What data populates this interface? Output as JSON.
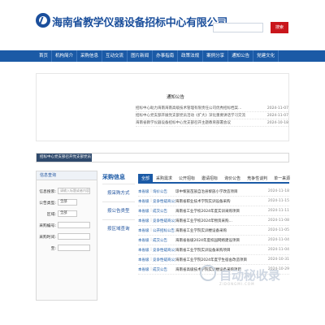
{
  "header": {
    "site_title": "海南省教学仪器设备招标中心有限公司",
    "search_placeholder": "",
    "search_label": "搜索"
  },
  "nav": {
    "items": [
      "首页",
      "机构简介",
      "采购信息",
      "互动交流",
      "图片新闻",
      "办事指南",
      "政策法规",
      "案例分享",
      "通知公告",
      "党建文化"
    ]
  },
  "notice": {
    "title": "通知公告",
    "rows": [
      {
        "title": "招标中心助力海南海南高级技术管理有限责任公司优秀招标档案…",
        "date": "2024-11-07"
      },
      {
        "title": "招标中心党支部开展党支部党员活动《扩大》深化重要讲话学习交流",
        "date": "2024-11-07"
      },
      {
        "title": "海南省教学仪器设备招标中心党支部召开主题教育部署会议",
        "date": "2024-10-18"
      }
    ]
  },
  "strip": {
    "label": "招标中心党支部召开党支部党员"
  },
  "left_panel": {
    "head": "信息查询",
    "keyword_label": "信息搜索:",
    "keyword_placeholder": "请输入标题或者内容",
    "type_label": "公告类型:",
    "type_value": "全部",
    "region_label": "区域:",
    "region_value": "全部",
    "code_label": "采购编号:",
    "from_label": "采购时间:",
    "to_label": "至:"
  },
  "caigou": {
    "head": "采购信息",
    "side": [
      "按采购方式",
      "按公告类型",
      "按区域查询"
    ]
  },
  "tabs": [
    "全部",
    "采购需求",
    "公开招标",
    "邀请招标",
    "询价公告",
    "竞争性谈判",
    "单一来源"
  ],
  "list": [
    {
      "src": "本省级",
      "cat": "询价公告",
      "title": "琼中黎族苗族自治县黎族小学改造项目",
      "date": "2024-11-18"
    },
    {
      "src": "本省级",
      "cat": "竞争性磋商公告",
      "title": "海南省职业技术学院实训设备采购",
      "date": "2024-11-15"
    },
    {
      "src": "本省级",
      "cat": "成交公告",
      "title": "海南省工业学校2024年度实训采购项目",
      "date": "2024-11-11"
    },
    {
      "src": "本省级",
      "cat": "竞争性磋商公告",
      "title": "海南省工业学校2024年物资采购…",
      "date": "2024-11-08"
    },
    {
      "src": "本省级",
      "cat": "公开招标公告",
      "title": "海南省工业学院实训楼设备采购",
      "date": "2024-11-05"
    },
    {
      "src": "本省级",
      "cat": "成交公告",
      "title": "海南省省级2024年度校园网络建设项目",
      "date": "2024-11-04"
    },
    {
      "src": "本省级",
      "cat": "竞争性磋商公告",
      "title": "海南省工业学院实训设备采购项目",
      "date": "2024-11-04"
    },
    {
      "src": "本省级",
      "cat": "竞争性磋商公告",
      "title": "海南省工业学院2024年度学生宿舍改造项目",
      "date": "2024-10-31"
    },
    {
      "src": "本省级",
      "cat": "成交公告",
      "title": "海南省高级技术学院实训楼设备采购项目",
      "date": "2024-10-29"
    }
  ],
  "watermark": {
    "text": "自动秘收录",
    "sub": "ZIDONGMI.COM"
  },
  "colors": {
    "brand_blue": "#1b5aa6",
    "search_red": "#c9161c"
  }
}
